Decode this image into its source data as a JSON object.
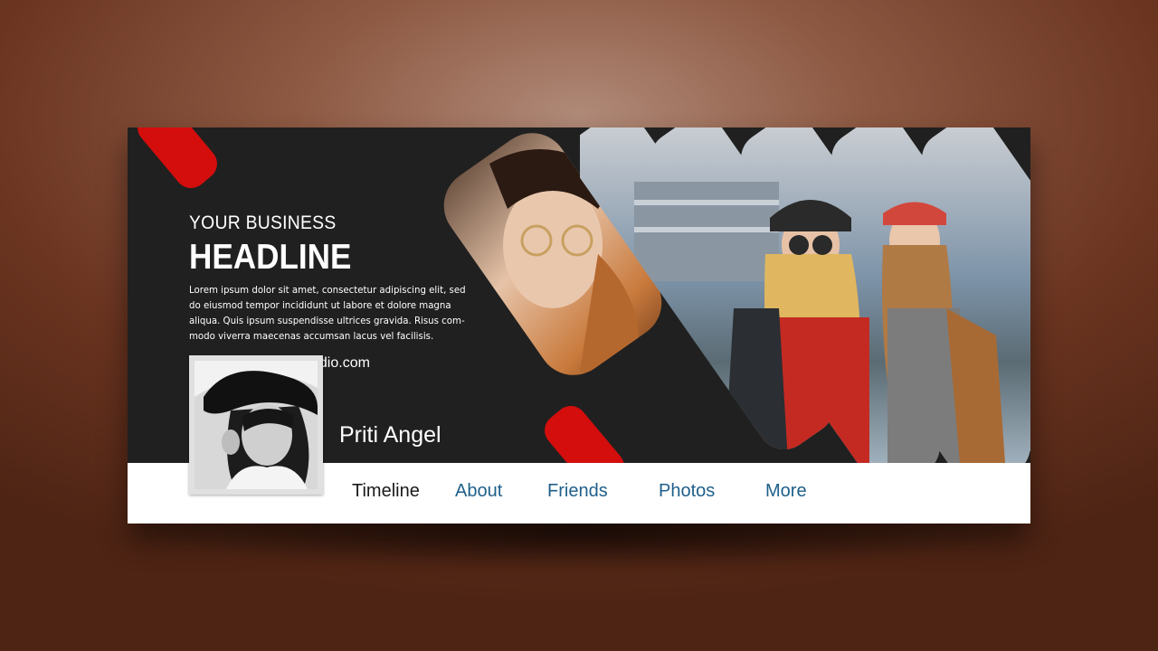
{
  "colors": {
    "accent": "#d40d0d",
    "banner_bg": "#202020",
    "nav_link": "#1f5f8a",
    "nav_active": "#1a1a1a"
  },
  "banner": {
    "eyebrow": "YOUR BUSINESS",
    "headline": "HEADLINE",
    "body": "Lorem ipsum dolor sit amet, consectetur adipiscing elit, sed\ndo eiusmod tempor incididunt ut labore et dolore magna\naliqua. Quis ipsum suspendisse ultrices gravida. Risus com-\nmodo viverra maecenas accumsan lacus vel facilisis.",
    "website": "udio.com"
  },
  "profile": {
    "name": "Priti Angel",
    "avatar_icon": "profile-photo"
  },
  "nav": {
    "items": [
      {
        "label": "Timeline",
        "active": true
      },
      {
        "label": "About",
        "active": false
      },
      {
        "label": "Friends",
        "active": false
      },
      {
        "label": "Photos",
        "active": false
      },
      {
        "label": "More",
        "active": false
      }
    ]
  }
}
